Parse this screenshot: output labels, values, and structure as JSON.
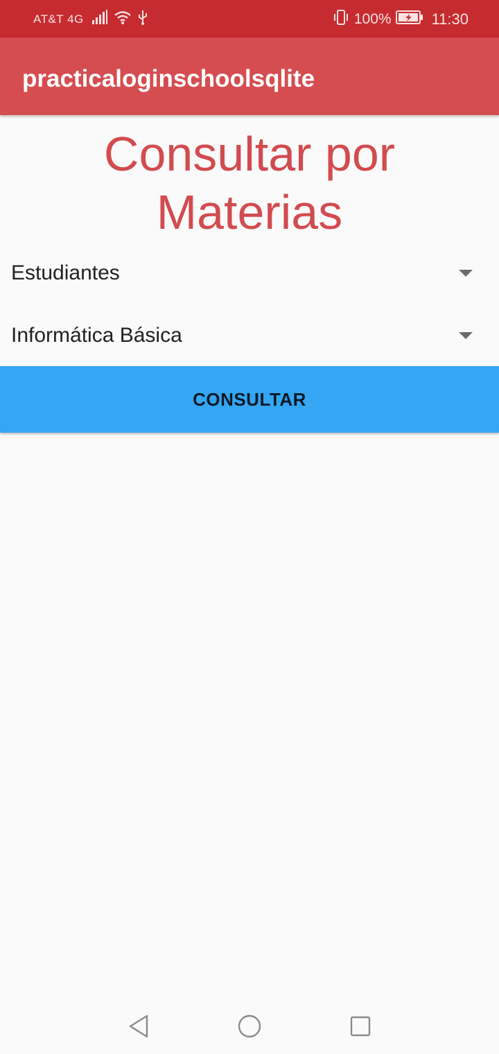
{
  "status_bar": {
    "carrier": "AT&T 4G",
    "battery_percent": "100%",
    "time": "11:30",
    "icons": [
      "signal-icon",
      "wifi-icon",
      "usb-icon",
      "vibrate-icon",
      "battery-charging-icon"
    ]
  },
  "app_bar": {
    "title": "practicaloginschoolsqlite"
  },
  "main": {
    "title_line1": "Consultar por",
    "title_line2": "Materias",
    "dropdown_students": {
      "selected": "Estudiantes"
    },
    "dropdown_subject": {
      "selected": "Informática Básica"
    },
    "consult_button_label": "CONSULTAR"
  },
  "nav_bar": {
    "icons": [
      "back-icon",
      "home-icon",
      "recents-icon"
    ]
  },
  "colors": {
    "status_bar": "#c62b2f",
    "app_bar": "#d54d50",
    "title_text": "#d24b4f",
    "button": "#35a6f4"
  }
}
